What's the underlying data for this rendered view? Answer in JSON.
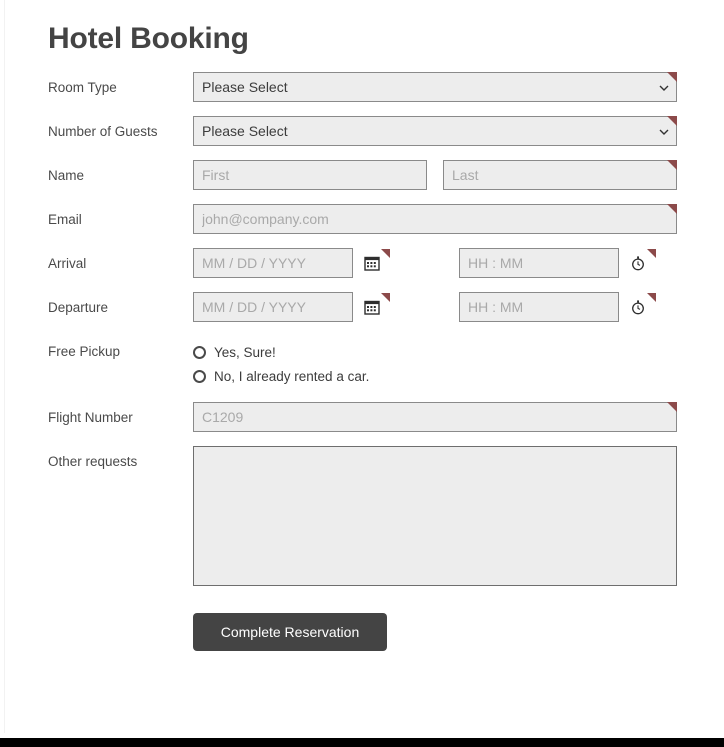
{
  "page": {
    "title": "Hotel Booking"
  },
  "fields": {
    "room_type": {
      "label": "Room Type",
      "value": "Please Select",
      "options": [
        "Please Select"
      ],
      "required": true
    },
    "guests": {
      "label": "Number of Guests",
      "value": "Please Select",
      "options": [
        "Please Select"
      ],
      "required": true
    },
    "name": {
      "label": "Name",
      "first_placeholder": "First",
      "first_value": "",
      "last_placeholder": "Last",
      "last_value": "",
      "required": true
    },
    "email": {
      "label": "Email",
      "placeholder": "john@company.com",
      "value": "",
      "required": true
    },
    "arrival": {
      "label": "Arrival",
      "date_placeholder": "MM / DD / YYYY",
      "date_value": "",
      "time_placeholder": "HH : MM",
      "time_value": "",
      "date_icon": "calendar-icon",
      "time_icon": "stopwatch-icon",
      "required": true
    },
    "departure": {
      "label": "Departure",
      "date_placeholder": "MM / DD / YYYY",
      "date_value": "",
      "time_placeholder": "HH : MM",
      "time_value": "",
      "date_icon": "calendar-icon",
      "time_icon": "stopwatch-icon",
      "required": true
    },
    "pickup": {
      "label": "Free Pickup",
      "options": [
        {
          "label": "Yes, Sure!",
          "selected": false
        },
        {
          "label": "No, I already rented a car.",
          "selected": false
        }
      ]
    },
    "flight_number": {
      "label": "Flight Number",
      "placeholder": "C1209",
      "value": "",
      "required": true
    },
    "other_requests": {
      "label": "Other requests",
      "placeholder": "",
      "value": "",
      "required": false
    }
  },
  "submit": {
    "label": "Complete Reservation"
  },
  "colors": {
    "required_flag": "#8c4a4a",
    "field_background": "#ededed",
    "field_border": "#8a8a8a",
    "placeholder": "#a9a9a9",
    "title": "#444444",
    "submit_background": "#444444",
    "submit_text": "#ffffff",
    "page_background": "#ffffff",
    "footer_bar": "#000000"
  }
}
